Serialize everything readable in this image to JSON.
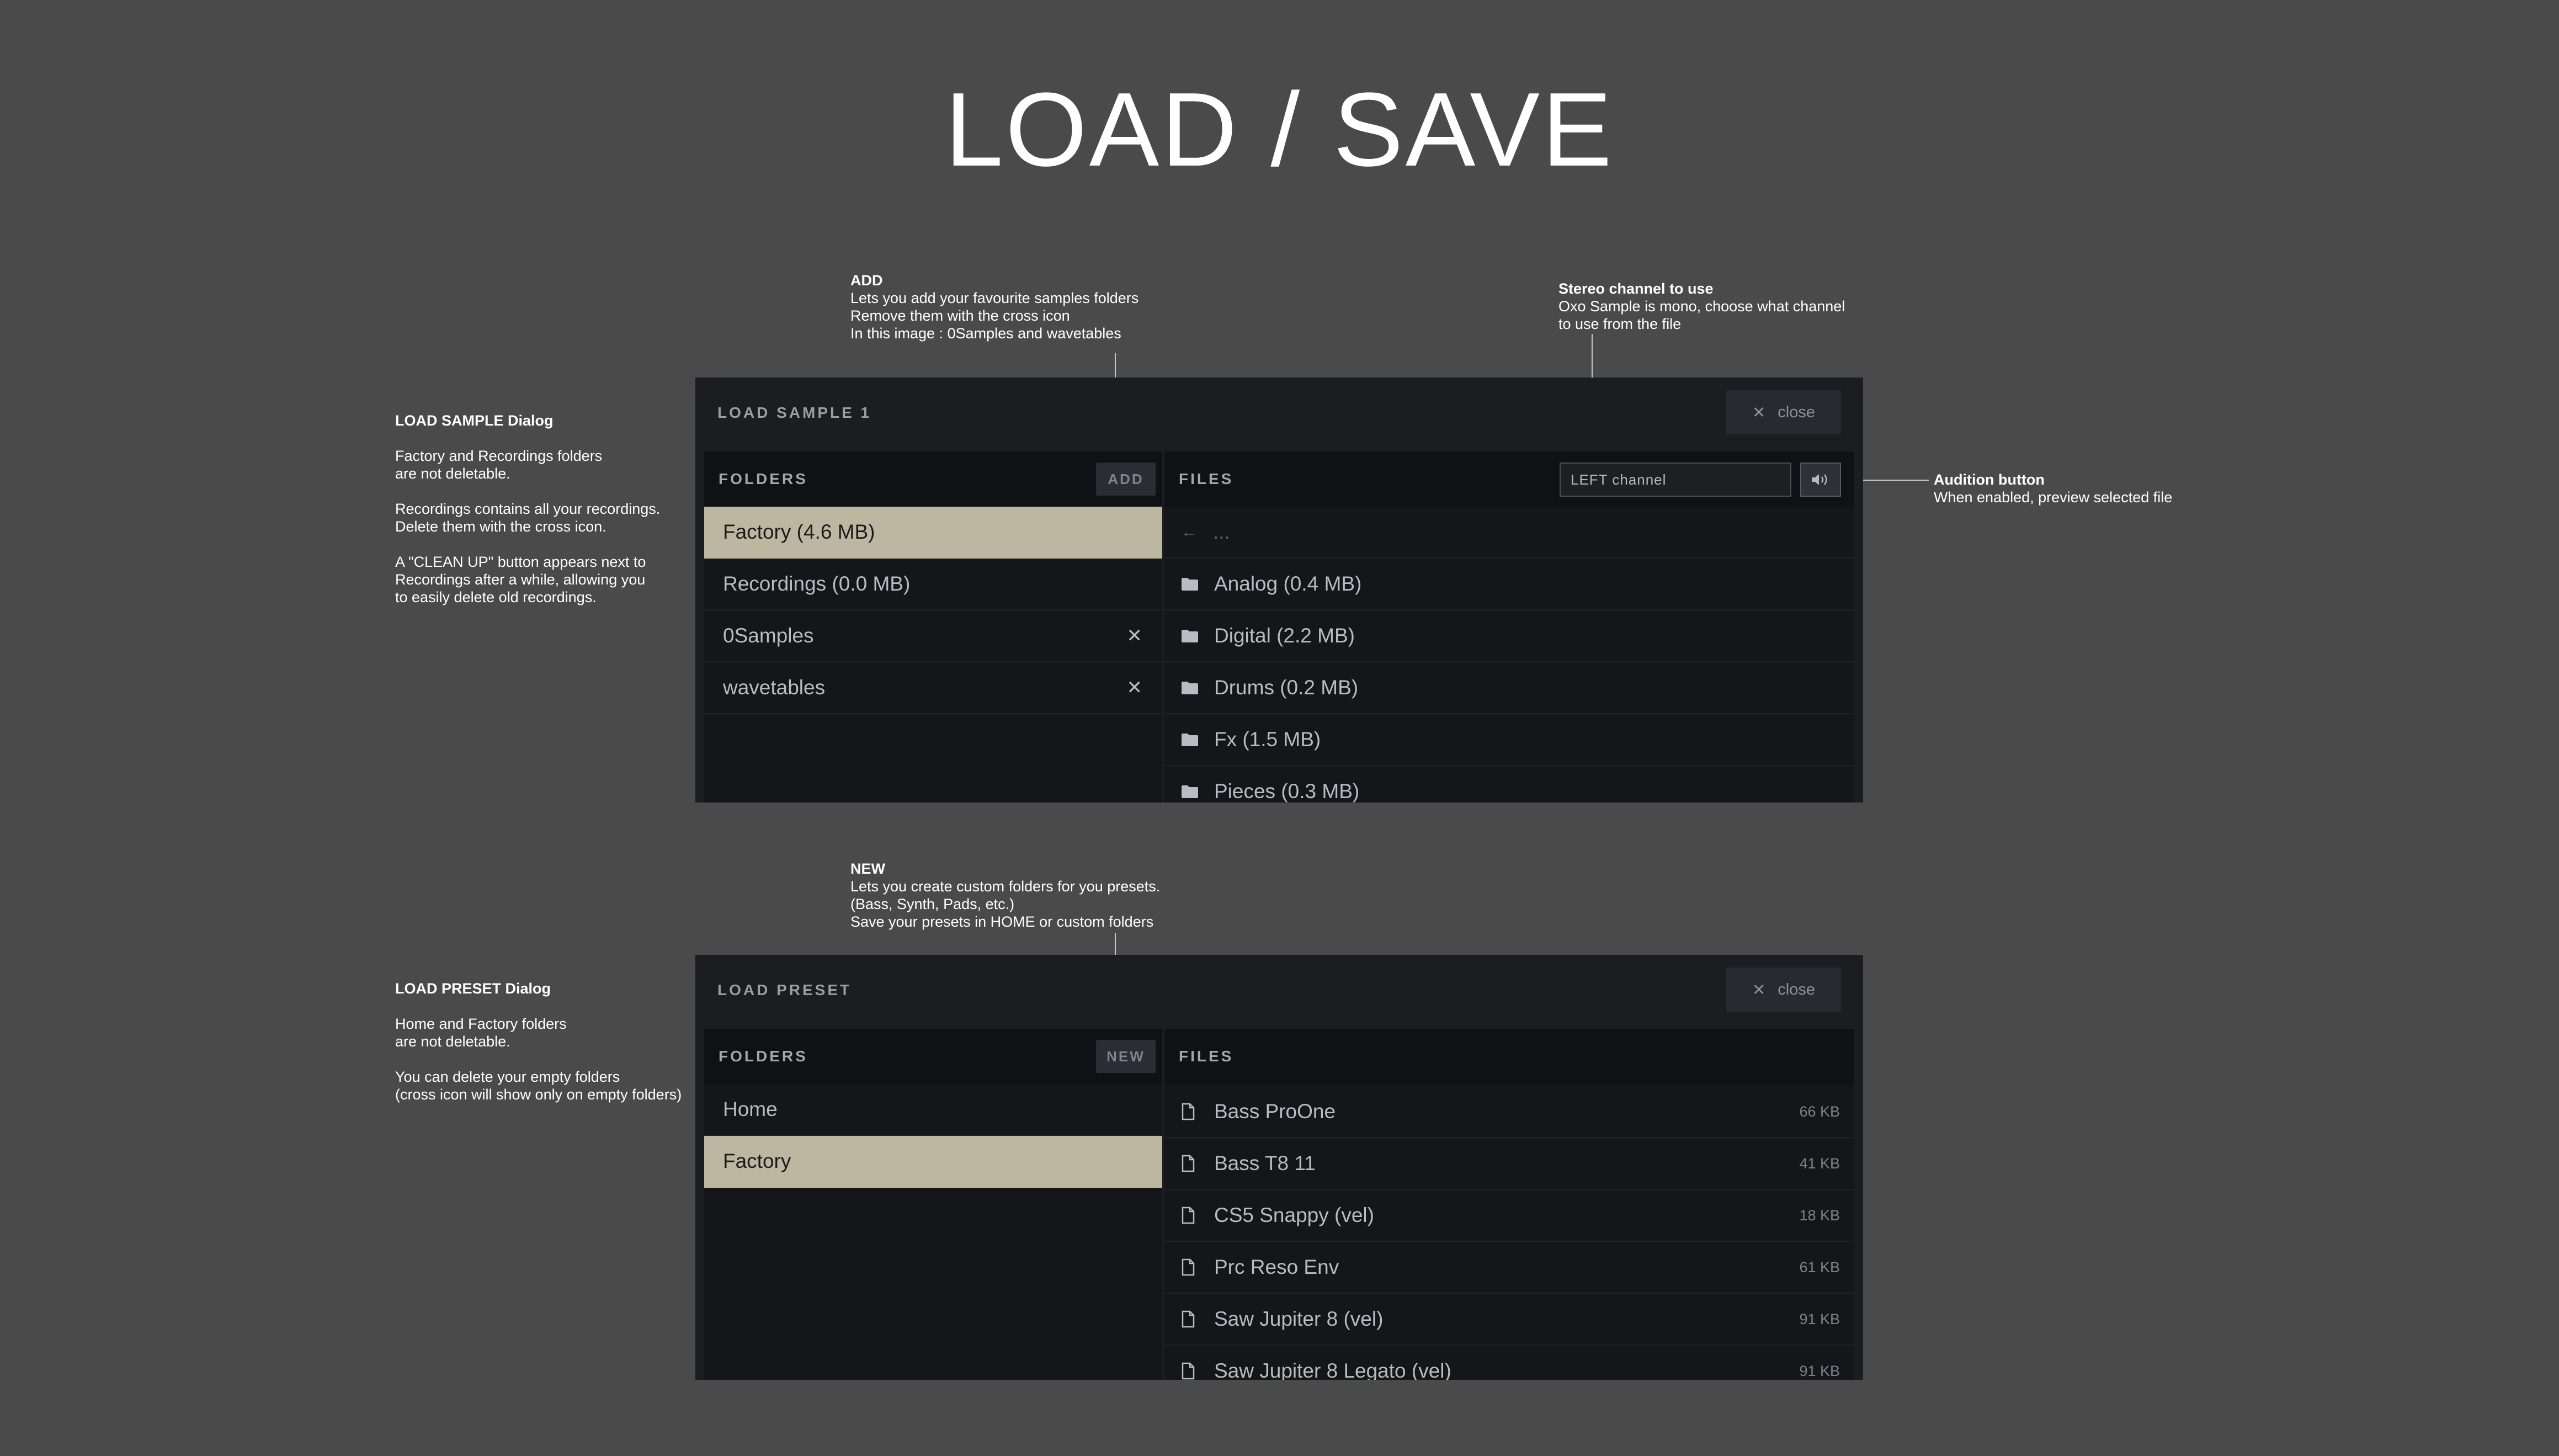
{
  "page_title": "LOAD / SAVE",
  "notes": {
    "add": {
      "heading": "ADD",
      "lines": [
        "Lets you add your favourite samples folders",
        "Remove them with the cross icon",
        "In this image : 0Samples and wavetables"
      ]
    },
    "stereo": {
      "heading": "Stereo channel to use",
      "lines": [
        "Oxo Sample is mono, choose what channel",
        "to use from the file"
      ]
    },
    "audition": {
      "heading": "Audition button",
      "lines": [
        "When enabled, preview selected file"
      ]
    },
    "load_sample": {
      "heading": "LOAD SAMPLE Dialog",
      "p1": [
        "Factory and Recordings folders",
        "are not deletable."
      ],
      "p2": [
        "Recordings contains all your recordings.",
        "Delete them with the cross icon."
      ],
      "p3": [
        "A \"CLEAN UP\" button appears next to",
        "Recordings after a while, allowing you",
        "to easily delete old recordings."
      ]
    },
    "new": {
      "heading": "NEW",
      "lines": [
        "Lets you create custom folders for you presets.",
        "(Bass, Synth, Pads, etc.)",
        "Save your presets in HOME or custom folders"
      ]
    },
    "load_preset": {
      "heading": "LOAD PRESET Dialog",
      "p1": [
        "Home and Factory folders",
        "are not deletable."
      ],
      "p2": [
        "You can delete your empty folders",
        "(cross icon will show only on empty folders)"
      ]
    }
  },
  "sample_dialog": {
    "title": "LOAD SAMPLE 1",
    "close_label": "close",
    "folders_label": "FOLDERS",
    "add_label": "ADD",
    "files_label": "FILES",
    "channel_value": "LEFT channel",
    "folders": [
      {
        "name": "Factory (4.6 MB)",
        "selected": true,
        "deletable": false
      },
      {
        "name": "Recordings (0.0 MB)",
        "selected": false,
        "deletable": false
      },
      {
        "name": "0Samples",
        "selected": false,
        "deletable": true
      },
      {
        "name": "wavetables",
        "selected": false,
        "deletable": true
      }
    ],
    "back_label": "...",
    "files": [
      "Analog (0.4 MB)",
      "Digital (2.2 MB)",
      "Drums (0.2 MB)",
      "Fx (1.5 MB)",
      "Pieces (0.3 MB)"
    ]
  },
  "preset_dialog": {
    "title": "LOAD PRESET",
    "close_label": "close",
    "folders_label": "FOLDERS",
    "new_label": "NEW",
    "files_label": "FILES",
    "folders": [
      {
        "name": "Home",
        "selected": false
      },
      {
        "name": "Factory",
        "selected": true
      }
    ],
    "files": [
      {
        "name": "Bass ProOne",
        "size": "66 KB"
      },
      {
        "name": "Bass T8 11",
        "size": "41 KB"
      },
      {
        "name": "CS5 Snappy (vel)",
        "size": "18 KB"
      },
      {
        "name": "Prc Reso Env",
        "size": "61 KB"
      },
      {
        "name": "Saw Jupiter 8 (vel)",
        "size": "91 KB"
      },
      {
        "name": "Saw Jupiter 8 Legato (vel)",
        "size": "91 KB"
      }
    ]
  },
  "colors": {
    "background": "#4a4a4a",
    "dialog": "#1b1d21",
    "selected_row": "#bdb7a1"
  }
}
